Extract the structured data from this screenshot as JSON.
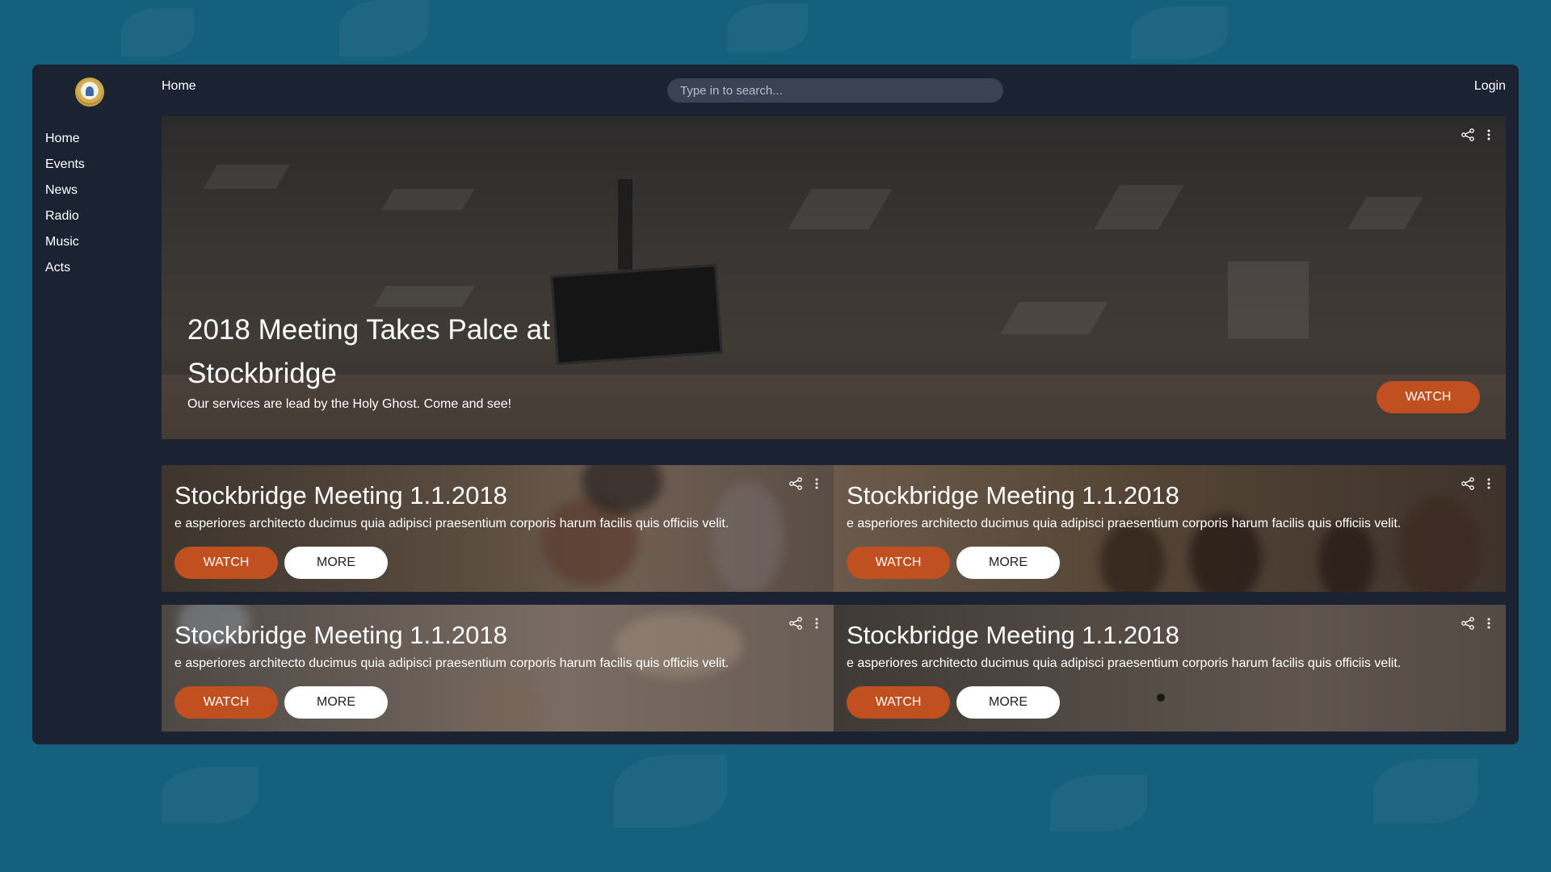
{
  "sidebar": {
    "items": [
      {
        "label": "Home"
      },
      {
        "label": "Events"
      },
      {
        "label": "News"
      },
      {
        "label": "Radio"
      },
      {
        "label": "Music"
      },
      {
        "label": "Acts"
      }
    ]
  },
  "header": {
    "breadcrumb": "Home",
    "search_placeholder": "Type in to search...",
    "login_label": "Login"
  },
  "hero": {
    "title": "2018 Meeting Takes Palce at Stockbridge",
    "subtitle": "Our services are lead by the Holy Ghost. Come and see!",
    "watch_label": "WATCH",
    "icons": [
      "share-icon",
      "more-vertical-icon"
    ]
  },
  "cards": [
    {
      "title": "Stockbridge Meeting 1.1.2018",
      "description": "e asperiores architecto ducimus quia adipisci praesentium corporis harum facilis quis officiis velit.",
      "watch_label": "WATCH",
      "more_label": "MORE"
    },
    {
      "title": "Stockbridge Meeting 1.1.2018",
      "description": "e asperiores architecto ducimus quia adipisci praesentium corporis harum facilis quis officiis velit.",
      "watch_label": "WATCH",
      "more_label": "MORE"
    },
    {
      "title": "Stockbridge Meeting 1.1.2018",
      "description": "e asperiores architecto ducimus quia adipisci praesentium corporis harum facilis quis officiis velit.",
      "watch_label": "WATCH",
      "more_label": "MORE"
    },
    {
      "title": "Stockbridge Meeting 1.1.2018",
      "description": "e asperiores architecto ducimus quia adipisci praesentium corporis harum facilis quis officiis velit.",
      "watch_label": "WATCH",
      "more_label": "MORE"
    }
  ],
  "colors": {
    "page_background": "#14607d",
    "app_background": "#1b2231",
    "watch_button": "#c0501f",
    "search_background": "#3a4253"
  }
}
